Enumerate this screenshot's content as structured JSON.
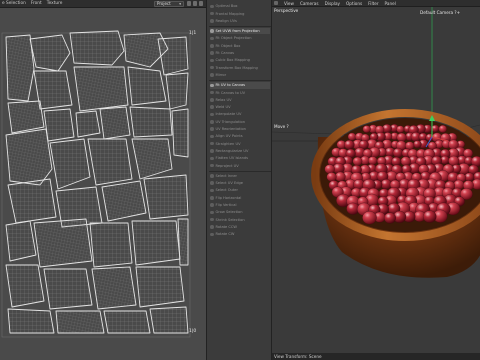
{
  "uv_editor": {
    "menu": [
      "e Selection",
      "Front",
      "Texture"
    ],
    "project_select": "Project",
    "corner_label_top_right": "1|1",
    "corner_label_bottom_right": "1|0"
  },
  "command_panel": {
    "items": [
      {
        "label": "Optimal Box",
        "active": false
      },
      {
        "label": "Frontal Mapping",
        "active": false
      },
      {
        "label": "Realign UVs",
        "active": false
      },
      {
        "label": "Set UVW from Projection",
        "active": true
      },
      {
        "label": "Fit Object Projection",
        "active": false
      },
      {
        "label": "Fit Object Box",
        "active": false
      },
      {
        "label": "Fit Canvas",
        "active": false
      },
      {
        "label": "Cubic Box Mapping",
        "active": false
      },
      {
        "label": "Transform Box Mapping",
        "active": false
      },
      {
        "label": "Mirror",
        "active": false
      },
      {
        "label": "Fit UV to Canvas",
        "active": true
      },
      {
        "label": "Fit Canvas to UV",
        "active": false
      },
      {
        "label": "Relax UV",
        "active": false
      },
      {
        "label": "Weld UV",
        "active": false
      },
      {
        "label": "Interpolate UV",
        "active": false
      },
      {
        "label": "UV Triangulation",
        "active": false
      },
      {
        "label": "UV Reorientation",
        "active": false
      },
      {
        "label": "Align UV Points",
        "active": false
      },
      {
        "label": "Straighten UV",
        "active": false
      },
      {
        "label": "Rectangularize UV",
        "active": false
      },
      {
        "label": "Flatten UV Islands",
        "active": false
      },
      {
        "label": "Reproject UV",
        "active": false
      },
      {
        "label": "Select Inner",
        "active": false
      },
      {
        "label": "Select UV Edge",
        "active": false
      },
      {
        "label": "Select Outer",
        "active": false
      },
      {
        "label": "Flip Horizontal",
        "active": false
      },
      {
        "label": "Flip Vertical",
        "active": false
      },
      {
        "label": "Grow Selection",
        "active": false
      },
      {
        "label": "Shrink Selection",
        "active": false
      },
      {
        "label": "Rotate CCW",
        "active": false
      },
      {
        "label": "Rotate CW",
        "active": false
      }
    ]
  },
  "viewport": {
    "menu": [
      "View",
      "Cameras",
      "Display",
      "Options",
      "Filter",
      "Panel"
    ],
    "view_name": "Perspective",
    "camera_name": "Default Camera ?+",
    "move_label": "Move ?",
    "status_text": "View Transform: Scene"
  },
  "colors": {
    "uv_background": "#4a4a4a",
    "uv_wire": "#d8d8d8",
    "bowl_rim": "#a85a22",
    "bowl_body": "#5e2f10",
    "berry": "#c0303f",
    "axis_y": "#38c060",
    "axis_x": "#d04040",
    "axis_z": "#4060d0"
  }
}
